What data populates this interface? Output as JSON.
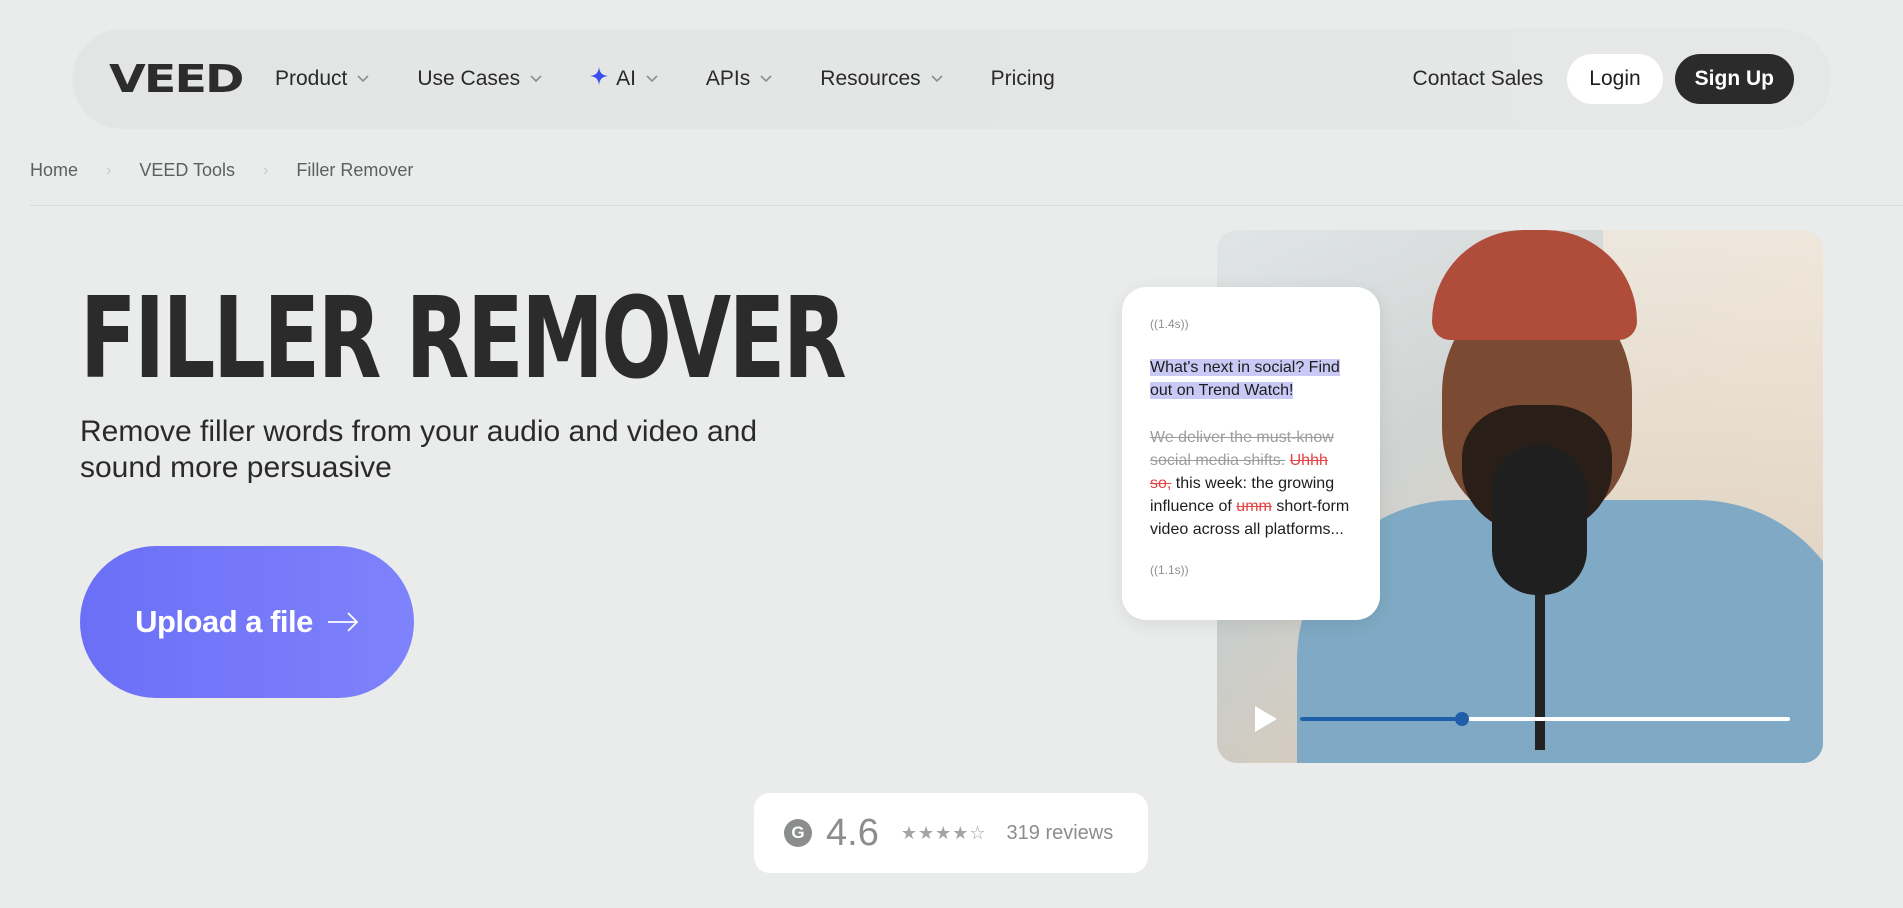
{
  "nav": {
    "logo": "VEED",
    "items": [
      {
        "label": "Product",
        "dropdown": true
      },
      {
        "label": "Use Cases",
        "dropdown": true
      },
      {
        "label": "AI",
        "dropdown": true,
        "icon": "sparkle-icon"
      },
      {
        "label": "APIs",
        "dropdown": true
      },
      {
        "label": "Resources",
        "dropdown": true
      },
      {
        "label": "Pricing",
        "dropdown": false
      }
    ],
    "contact": "Contact Sales",
    "login": "Login",
    "signup": "Sign Up"
  },
  "breadcrumb": [
    "Home",
    "VEED Tools",
    "Filler Remover"
  ],
  "hero": {
    "title": "FILLER REMOVER",
    "subtitle": "Remove filler words from your audio and video and sound more persuasive",
    "cta": "Upload a file"
  },
  "transcript": {
    "pause_top": "((1.4s))",
    "highlight": "What's next in social? Find out on Trend Watch!",
    "struck": "We deliver the must-know social media shifts.",
    "filler1": "Uhhh so,",
    "text1": "this week: the growing influence of",
    "filler2": "umm",
    "text2": "short-form video across all platforms...",
    "pause_bottom": "((1.1s))"
  },
  "video": {
    "progress": 0.33
  },
  "rating": {
    "score": "4.6",
    "reviews": "319 reviews",
    "stars": 4.5
  },
  "colors": {
    "accent": "#6b6ff7",
    "highlight": "#c9c9f6",
    "filler": "#e54545"
  }
}
